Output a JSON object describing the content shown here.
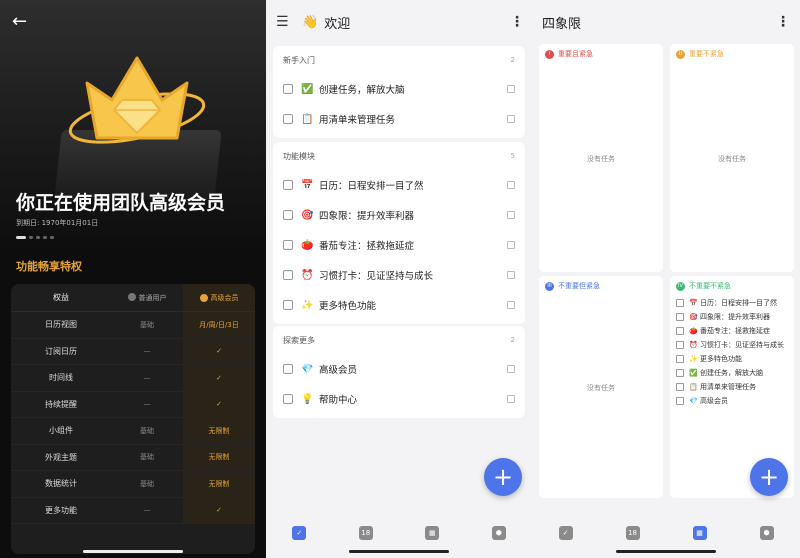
{
  "panel1": {
    "hero_title": "你正在使用团队高级会员",
    "expire_date": "到期日: 1970年01月01日",
    "features_title": "功能畅享特权",
    "table_header": {
      "col1": "权益",
      "col2": "普通用户",
      "col3": "高级会员"
    },
    "rows": [
      {
        "name": "日历视图",
        "basic": "基础",
        "premium": "月/周/日/3日"
      },
      {
        "name": "订阅日历",
        "basic": "—",
        "premium": "✓"
      },
      {
        "name": "时间线",
        "basic": "—",
        "premium": "✓"
      },
      {
        "name": "持续提醒",
        "basic": "—",
        "premium": "✓"
      },
      {
        "name": "小组件",
        "basic": "基础",
        "premium": "无限制"
      },
      {
        "name": "外观主题",
        "basic": "基础",
        "premium": "无限制"
      },
      {
        "name": "数据统计",
        "basic": "基础",
        "premium": "无限制"
      },
      {
        "name": "更多功能",
        "basic": "—",
        "premium": "✓"
      }
    ],
    "colors": {
      "accent": "#e7a33a",
      "background": "#0d0d0d"
    }
  },
  "panel2": {
    "title": "欢迎",
    "title_emoji": "👋",
    "sections": [
      {
        "name": "新手入门",
        "count": "2",
        "items": [
          {
            "emoji": "✅",
            "text": "创建任务，解放大脑"
          },
          {
            "emoji": "📋",
            "text": "用清单来管理任务"
          }
        ]
      },
      {
        "name": "功能模块",
        "count": "5",
        "items": [
          {
            "emoji": "📅",
            "text": "日历：日程安排一目了然"
          },
          {
            "emoji": "🎯",
            "text": "四象限：提升效率利器"
          },
          {
            "emoji": "🍅",
            "text": "番茄专注：拯救拖延症"
          },
          {
            "emoji": "⏰",
            "text": "习惯打卡：见证坚持与成长"
          },
          {
            "emoji": "✨",
            "text": "更多特色功能"
          }
        ]
      },
      {
        "name": "探索更多",
        "count": "2",
        "items": [
          {
            "emoji": "💎",
            "text": "高级会员"
          },
          {
            "emoji": "💡",
            "text": "帮助中心"
          }
        ]
      }
    ],
    "fab": "+",
    "tabs": [
      {
        "icon": "checkbox-icon",
        "glyph": "✓"
      },
      {
        "icon": "calendar-icon",
        "glyph": "18"
      },
      {
        "icon": "grid-icon",
        "glyph": "▦"
      },
      {
        "icon": "hexagon-icon",
        "glyph": "⬢"
      }
    ],
    "colors": {
      "accent": "#4d74e8"
    }
  },
  "panel3": {
    "title": "四象限",
    "quadrants": [
      {
        "num": "I",
        "name": "重要且紧急",
        "color": "#e04c4c",
        "empty": "没有任务"
      },
      {
        "num": "II",
        "name": "重要不紧急",
        "color": "#e8a23a",
        "empty": "没有任务"
      },
      {
        "num": "III",
        "name": "不重要但紧急",
        "color": "#4d74e8",
        "empty": "没有任务"
      },
      {
        "num": "IV",
        "name": "不重要不紧急",
        "color": "#3cb878",
        "empty": ""
      }
    ],
    "q4_items": [
      {
        "emoji": "📅",
        "text": "日历：日程安排一目了然"
      },
      {
        "emoji": "🎯",
        "text": "四象限：提升效率利器"
      },
      {
        "emoji": "🍅",
        "text": "番茄专注：拯救拖延症"
      },
      {
        "emoji": "⏰",
        "text": "习惯打卡：见证坚持与成长"
      },
      {
        "emoji": "✨",
        "text": "更多特色功能"
      },
      {
        "emoji": "✅",
        "text": "创建任务，解放大脑"
      },
      {
        "emoji": "📋",
        "text": "用清单来管理任务"
      },
      {
        "emoji": "💎",
        "text": "高级会员"
      }
    ],
    "fab": "+",
    "tabs": [
      {
        "icon": "checkbox-icon",
        "glyph": "✓"
      },
      {
        "icon": "calendar-icon",
        "glyph": "18"
      },
      {
        "icon": "grid-icon",
        "glyph": "▦"
      },
      {
        "icon": "hexagon-icon",
        "glyph": "⬢"
      }
    ]
  }
}
